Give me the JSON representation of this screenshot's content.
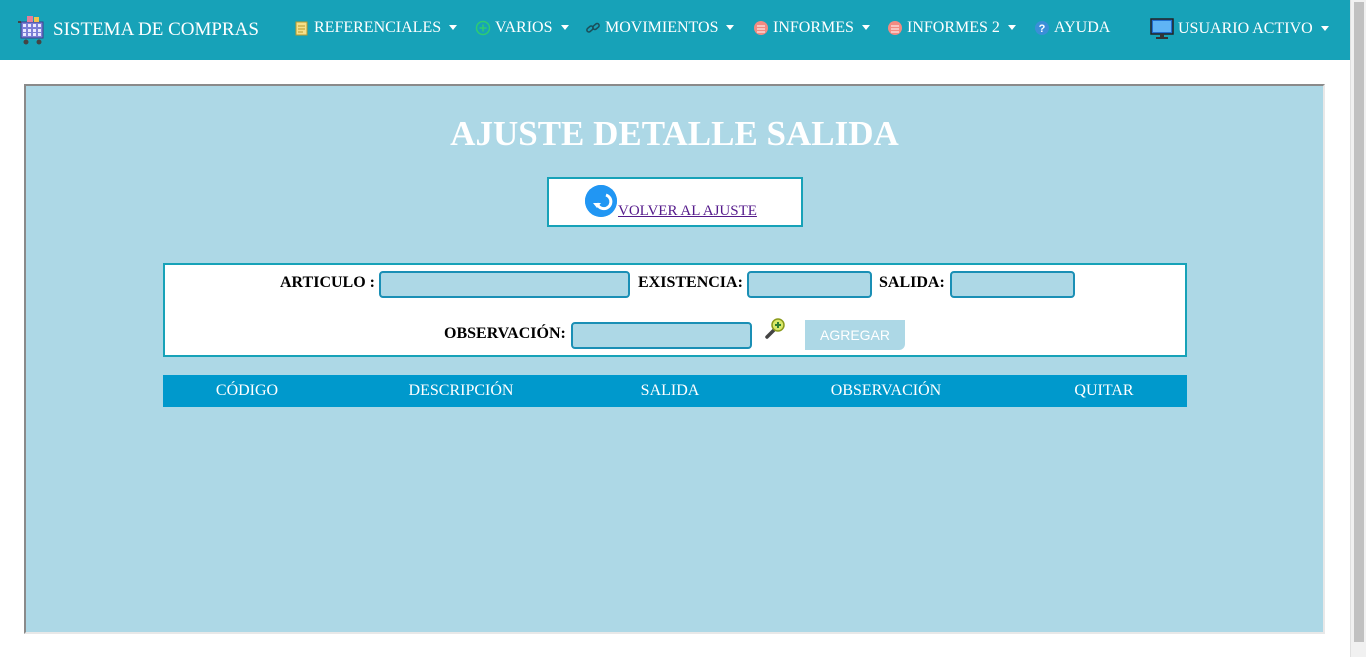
{
  "navbar": {
    "brand": "SISTEMA DE COMPRAS",
    "items": [
      {
        "label": "REFERENCIALES",
        "icon": "notepad-icon",
        "dropdown": true
      },
      {
        "label": "VARIOS",
        "icon": "plus-circle-icon",
        "dropdown": true
      },
      {
        "label": "MOVIMIENTOS",
        "icon": "link-icon",
        "dropdown": true
      },
      {
        "label": "INFORMES",
        "icon": "report-icon",
        "dropdown": true
      },
      {
        "label": "INFORMES 2",
        "icon": "report-icon",
        "dropdown": true
      },
      {
        "label": "AYUDA",
        "icon": "help-icon",
        "dropdown": false
      }
    ],
    "user": {
      "label": "USUARIO ACTIVO",
      "icon": "monitor-icon"
    }
  },
  "page": {
    "title": "AJUSTE DETALLE SALIDA",
    "back_link": "VOLVER AL AJUSTE"
  },
  "form": {
    "articulo_label": "ARTICULO :",
    "articulo_value": "",
    "existencia_label": "EXISTENCIA:",
    "existencia_value": "",
    "salida_label": "SALIDA:",
    "salida_value": "",
    "observacion_label": "OBSERVACIÓN:",
    "observacion_value": "",
    "add_button": "AGREGAR"
  },
  "table": {
    "columns": [
      "CÓDIGO",
      "DESCRIPCIÓN",
      "SALIDA",
      "OBSERVACIÓN",
      "QUITAR"
    ],
    "rows": []
  },
  "colors": {
    "navbar": "#17a2b8",
    "panel": "#add8e6",
    "table_header": "#0099cc"
  }
}
